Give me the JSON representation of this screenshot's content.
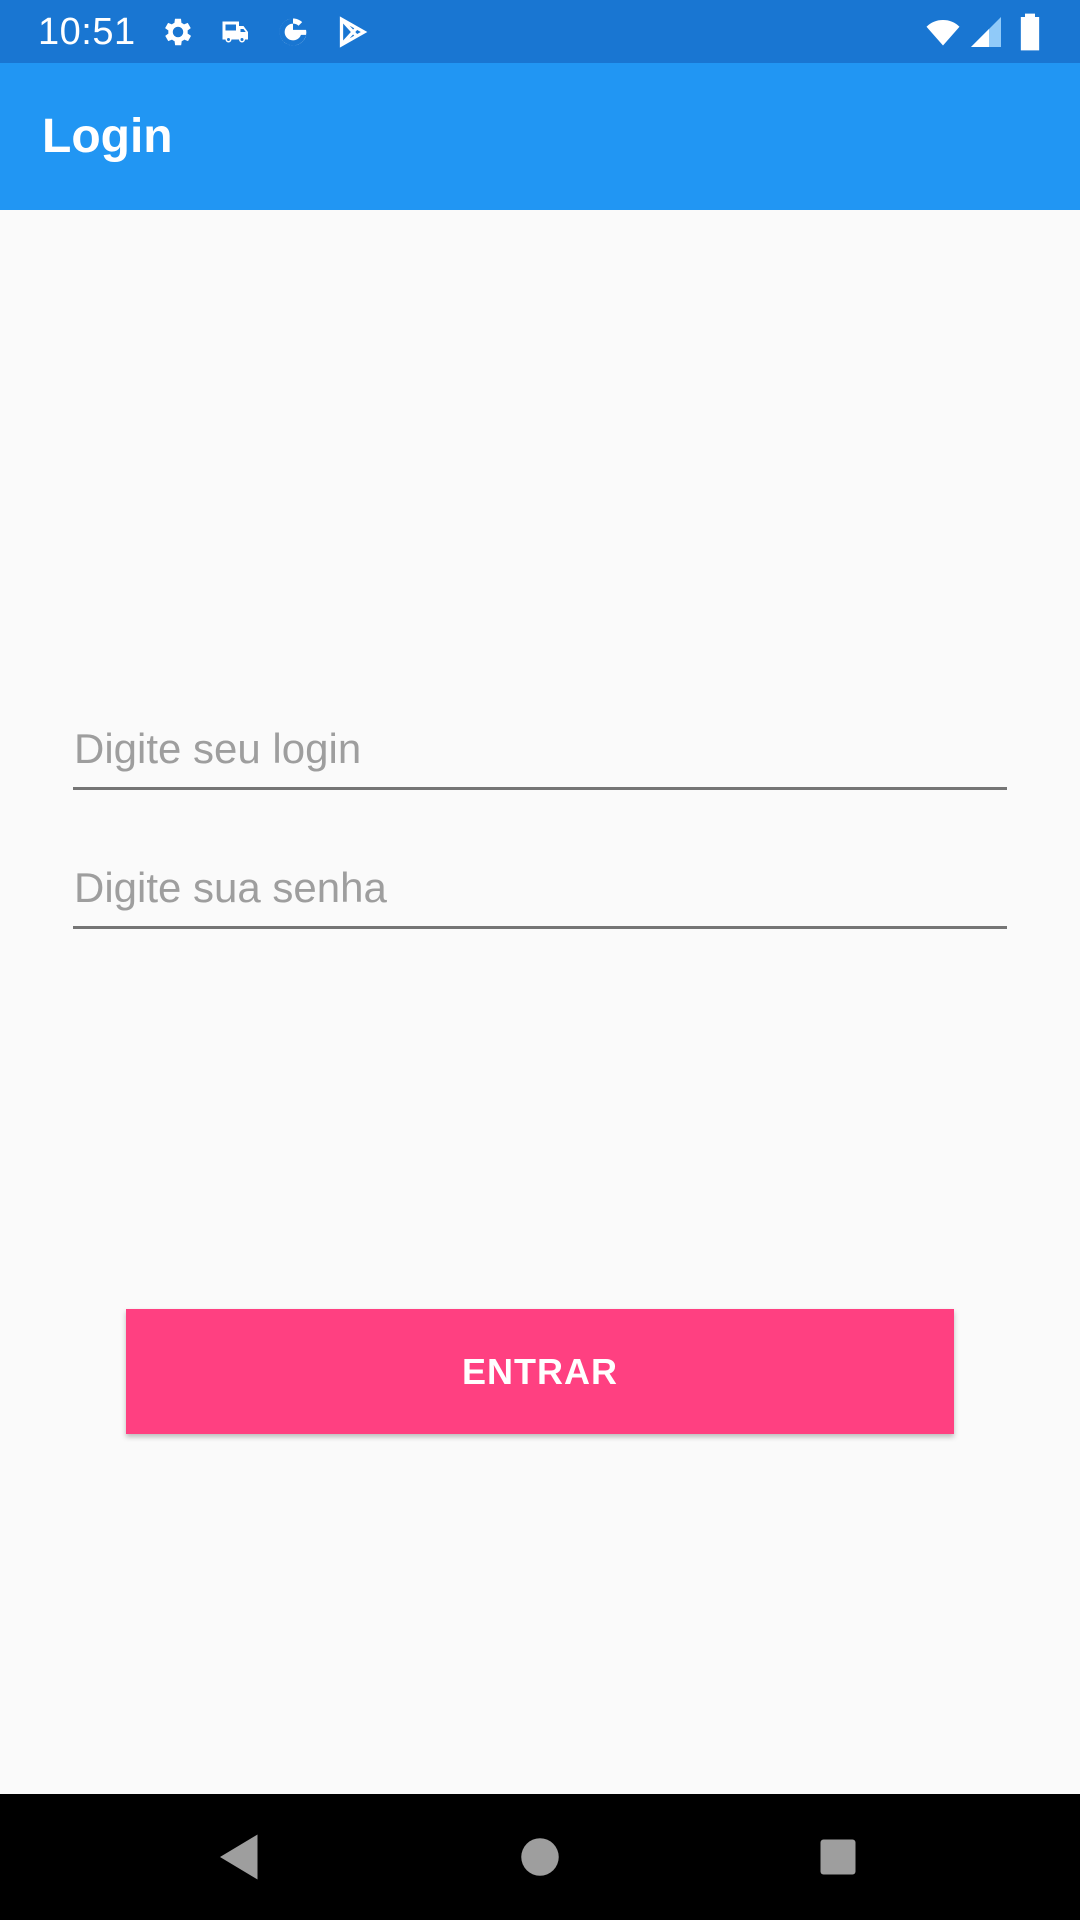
{
  "status_bar": {
    "time": "10:51",
    "icons": [
      "settings-icon",
      "car-icon",
      "google-icon",
      "play-store-icon",
      "wifi-icon",
      "signal-icon",
      "battery-icon"
    ],
    "background_color": "#1976d2"
  },
  "app_bar": {
    "title": "Login",
    "background_color": "#2196f3"
  },
  "form": {
    "login": {
      "placeholder": "Digite seu login",
      "value": ""
    },
    "senha": {
      "placeholder": "Digite sua senha",
      "value": ""
    },
    "submit_label": "ENTRAR",
    "accent_color": "#ff4081"
  },
  "nav_bar": {
    "buttons": [
      "back-icon",
      "home-icon",
      "recents-icon"
    ]
  }
}
